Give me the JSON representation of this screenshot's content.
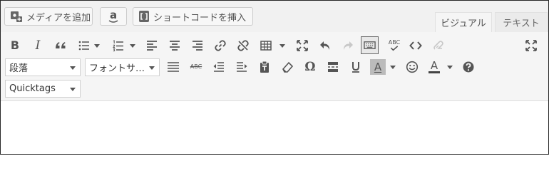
{
  "media_buttons": {
    "add_media": "メディアを追加",
    "amazon": "a",
    "shortcode": "ショートコードを挿入"
  },
  "tabs": {
    "visual": "ビジュアル",
    "text": "テキスト"
  },
  "toolbar": {
    "row2": {
      "format_select": "段落",
      "font_select": "フォントサ…",
      "strikethrough": "ABC",
      "text_color_letter": "A",
      "bg_color_letter": "A"
    },
    "row3": {
      "quicktags_select": "Quicktags"
    },
    "row1": {
      "spellcheck": "ABC"
    }
  },
  "colors": {
    "text_color_bar": "#444444",
    "bg_color_fill": "#bbbbbb"
  }
}
